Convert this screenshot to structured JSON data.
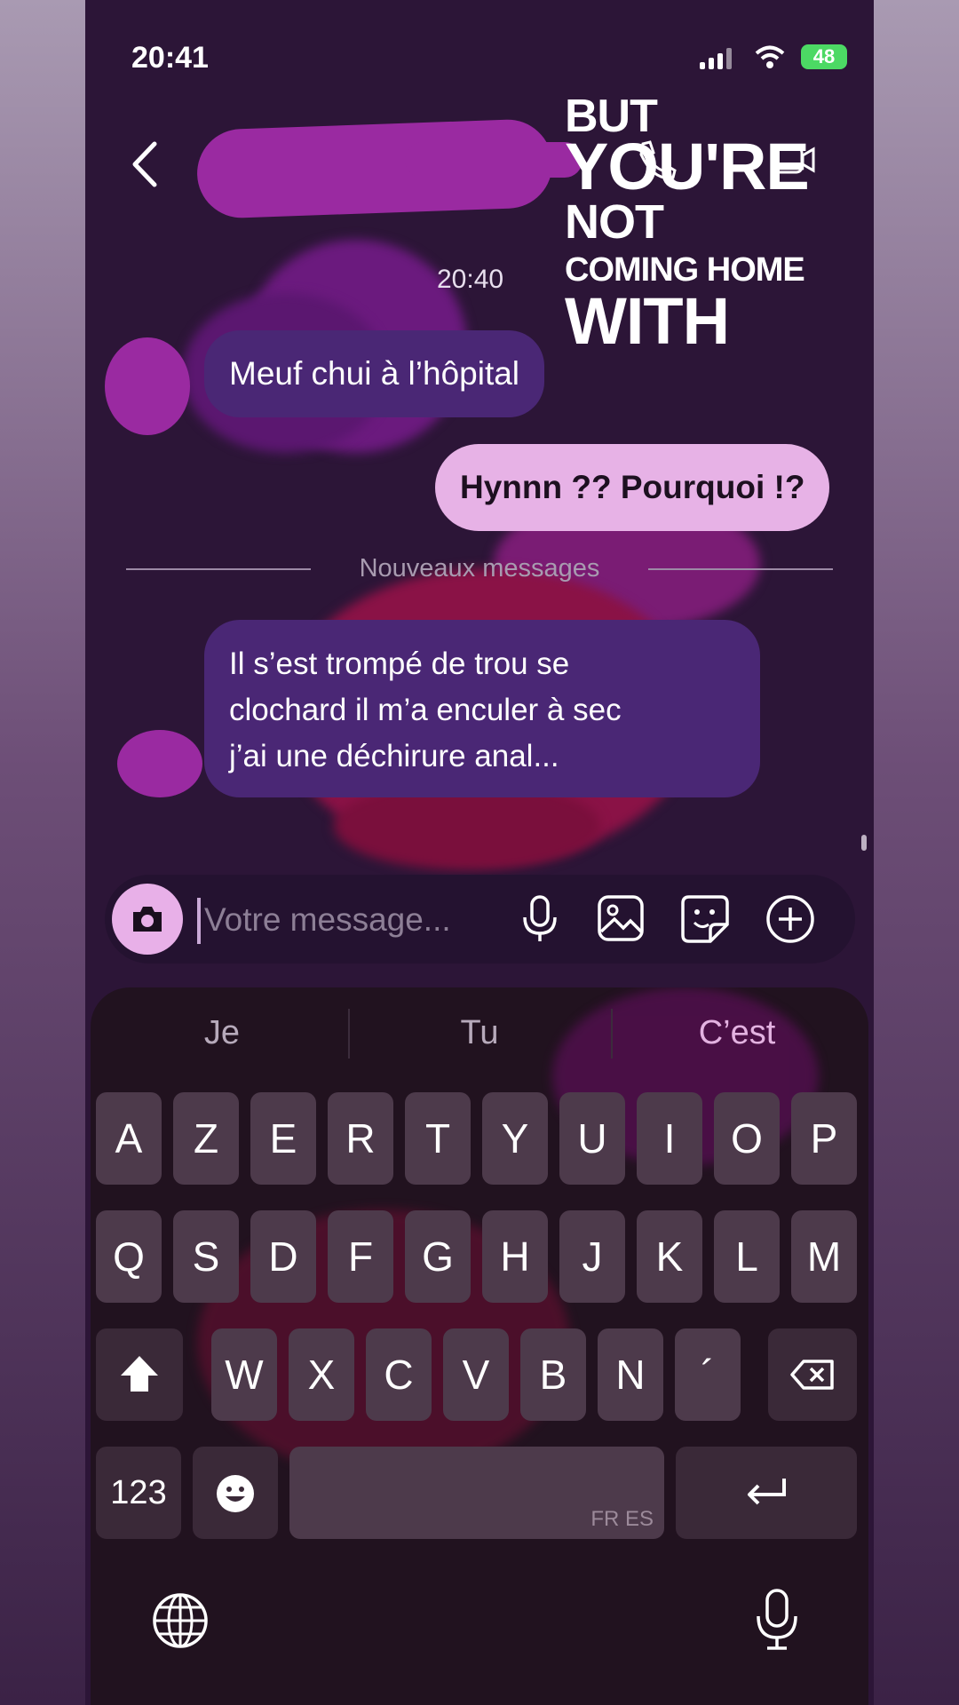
{
  "status_bar": {
    "time": "20:41",
    "battery": "48"
  },
  "header": {
    "back_icon": "chevron-left-icon"
  },
  "overlay_caption": {
    "lines": [
      "BUT",
      "YOU'RE",
      "NOT",
      "COMING HOME",
      "WITH"
    ]
  },
  "chat": {
    "timestamp": "20:40",
    "messages": [
      {
        "direction": "incoming",
        "text": "Meuf chui à l’hôpital"
      },
      {
        "direction": "outgoing",
        "text": "Hynnn ?? Pourquoi !?"
      },
      {
        "direction": "incoming",
        "lines": [
          "Il s’est trompé de trou se",
          "clochard il m’a enculer à sec",
          "j’ai une déchirure anal..."
        ]
      }
    ],
    "separator": "Nouveaux messages"
  },
  "composer": {
    "placeholder": "Votre message...",
    "icons": [
      "camera-icon",
      "microphone-icon",
      "gallery-icon",
      "sticker-icon",
      "add-icon"
    ]
  },
  "keyboard": {
    "suggestions": [
      "Je",
      "Tu",
      "C’est"
    ],
    "row1": [
      "A",
      "Z",
      "E",
      "R",
      "T",
      "Y",
      "U",
      "I",
      "O",
      "P"
    ],
    "row2": [
      "Q",
      "S",
      "D",
      "F",
      "G",
      "H",
      "J",
      "K",
      "L",
      "M"
    ],
    "row3": [
      "W",
      "X",
      "C",
      "V",
      "B",
      "N",
      "´"
    ],
    "numbers_label": "123",
    "space_label": "FR ES",
    "icons": [
      "shift-icon",
      "delete-icon",
      "emoji-icon",
      "return-icon",
      "globe-icon",
      "dictation-icon"
    ]
  },
  "colors": {
    "incoming_bubble": "#4a2775",
    "outgoing_bubble": "#e7b2e6",
    "background": "#2c1537"
  }
}
